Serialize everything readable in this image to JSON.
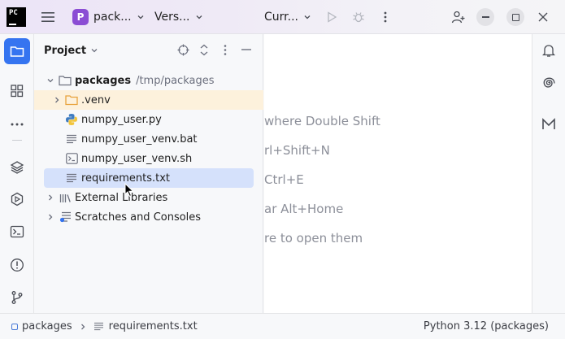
{
  "titlebar": {
    "ide_logo_text": "PC",
    "project_badge": "P",
    "project_name": "pack...",
    "vcs_label": "Vers...",
    "run_config": "Curr..."
  },
  "project_panel": {
    "title": "Project",
    "tree": [
      {
        "label": "packages",
        "path": "/tmp/packages"
      },
      {
        "label": ".venv"
      },
      {
        "label": "numpy_user.py"
      },
      {
        "label": "numpy_user_venv.bat"
      },
      {
        "label": "numpy_user_venv.sh"
      },
      {
        "label": "requirements.txt"
      },
      {
        "label": "External Libraries"
      },
      {
        "label": "Scratches and Consoles"
      }
    ]
  },
  "editor": {
    "hints": [
      "where Double Shift",
      "rl+Shift+N",
      "Ctrl+E",
      "ar Alt+Home",
      "re to open them"
    ]
  },
  "statusbar": {
    "crumb_project": "packages",
    "crumb_file": "requirements.txt",
    "interpreter": "Python 3.12 (packages)"
  },
  "colors": {
    "accent": "#3574f0",
    "project_badge": "#8b4dd4",
    "selection": "#d5e1fb",
    "venv_highlight": "#fdf1dc",
    "folder_orange": "#e8a33d"
  }
}
